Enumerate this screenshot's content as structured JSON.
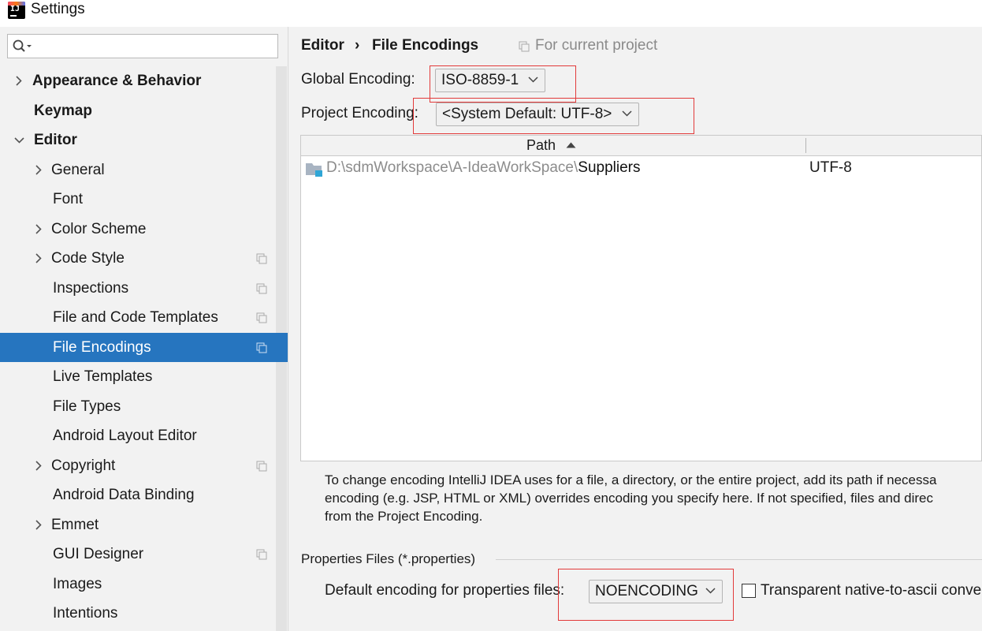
{
  "window": {
    "title": "Settings"
  },
  "search": {
    "placeholder": "",
    "value": ""
  },
  "sidebar": {
    "items": [
      {
        "label": "Appearance & Behavior"
      },
      {
        "label": "Keymap"
      },
      {
        "label": "Editor"
      },
      {
        "label": "General"
      },
      {
        "label": "Font"
      },
      {
        "label": "Color Scheme"
      },
      {
        "label": "Code Style"
      },
      {
        "label": "Inspections"
      },
      {
        "label": "File and Code Templates"
      },
      {
        "label": "File Encodings"
      },
      {
        "label": "Live Templates"
      },
      {
        "label": "File Types"
      },
      {
        "label": "Android Layout Editor"
      },
      {
        "label": "Copyright"
      },
      {
        "label": "Android Data Binding"
      },
      {
        "label": "Emmet"
      },
      {
        "label": "GUI Designer"
      },
      {
        "label": "Images"
      },
      {
        "label": "Intentions"
      }
    ],
    "selected": "File Encodings"
  },
  "breadcrumb": {
    "parent": "Editor",
    "separator": "›",
    "current": "File Encodings",
    "scope": "For current project"
  },
  "global_encoding": {
    "label": "Global Encoding:",
    "value": "ISO-8859-1"
  },
  "project_encoding": {
    "label": "Project Encoding:",
    "value": "<System Default: UTF-8>"
  },
  "table": {
    "columns": [
      "Path",
      ""
    ],
    "sort": "ascending",
    "rows": [
      {
        "path_prefix": "D:\\sdmWorkspace\\A-IdeaWorkSpace\\",
        "path_name": "Suppliers",
        "encoding": "UTF-8"
      }
    ]
  },
  "help": {
    "lines": [
      "To change encoding IntelliJ IDEA uses for a file, a directory, or the entire project, add its path if necessa",
      "encoding (e.g. JSP, HTML or XML) overrides encoding you specify here. If not specified, files and direc",
      "from the Project Encoding."
    ]
  },
  "properties": {
    "section_title": "Properties Files (*.properties)",
    "default_label": "Default encoding for properties files:",
    "default_value": "NOENCODING",
    "transparent_label": "Transparent native-to-ascii conve",
    "transparent_checked": false
  },
  "colors": {
    "selection": "#2675bf",
    "highlight_box": "#e23a3a",
    "panel_bg": "#f2f2f2"
  }
}
